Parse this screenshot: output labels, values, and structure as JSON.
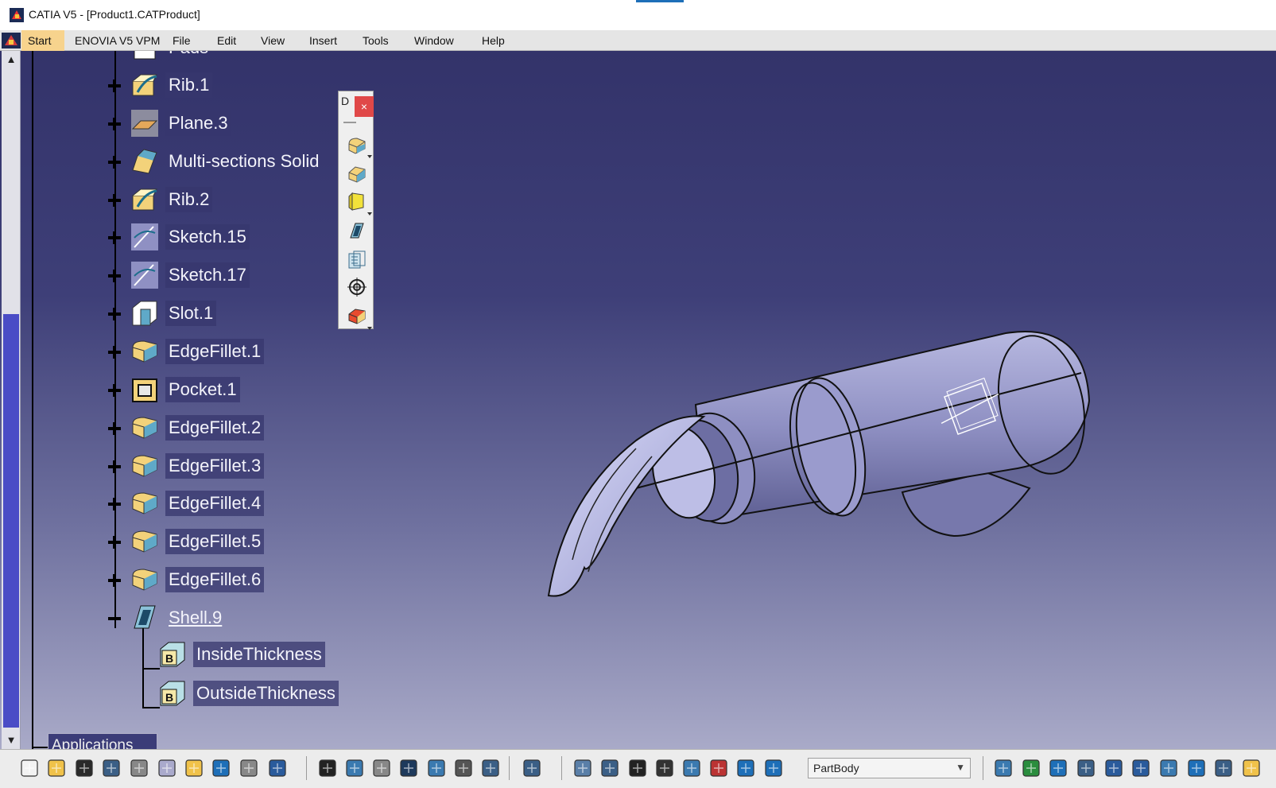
{
  "window": {
    "title": "CATIA V5 - [Product1.CATProduct]"
  },
  "menubar": {
    "items": [
      "Start",
      "ENOVIA V5 VPM",
      "File",
      "Edit",
      "View",
      "Insert",
      "Tools",
      "Window",
      "Help"
    ]
  },
  "tree": {
    "partial_top_label": "Pads",
    "nodes": [
      {
        "label": "Rib.1",
        "icon": "rib-icon"
      },
      {
        "label": "Plane.3",
        "icon": "plane-icon"
      },
      {
        "label": "Multi-sections Solid",
        "icon": "multi-sections-solid-icon"
      },
      {
        "label": "Rib.2",
        "icon": "rib-icon"
      },
      {
        "label": "Sketch.15",
        "icon": "sketch-icon"
      },
      {
        "label": "Sketch.17",
        "icon": "sketch-icon"
      },
      {
        "label": "Slot.1",
        "icon": "slot-icon"
      },
      {
        "label": "EdgeFillet.1",
        "icon": "edge-fillet-icon"
      },
      {
        "label": "Pocket.1",
        "icon": "pocket-icon"
      },
      {
        "label": "EdgeFillet.2",
        "icon": "edge-fillet-icon"
      },
      {
        "label": "EdgeFillet.3",
        "icon": "edge-fillet-icon"
      },
      {
        "label": "EdgeFillet.4",
        "icon": "edge-fillet-icon"
      },
      {
        "label": "EdgeFillet.5",
        "icon": "edge-fillet-icon"
      },
      {
        "label": "EdgeFillet.6",
        "icon": "edge-fillet-icon"
      },
      {
        "label": "Shell.9",
        "icon": "shell-icon"
      }
    ],
    "children": [
      {
        "label": "InsideThickness",
        "icon": "parameter-icon"
      },
      {
        "label": "OutsideThickness",
        "icon": "parameter-icon"
      }
    ]
  },
  "floating_toolbar": {
    "title": "D",
    "close": "×",
    "buttons": [
      "fillet-icon",
      "chamfer-icon",
      "draft-icon",
      "shell-icon",
      "thickness-icon",
      "thread-icon",
      "remove-face-icon"
    ]
  },
  "status": {
    "applications_tab": "Applications"
  },
  "bottom_toolbar": {
    "body_select_value": "PartBody",
    "tools": [
      "new-icon",
      "open-icon",
      "save-icon",
      "print-icon",
      "cut-icon",
      "copy-icon",
      "paste-icon",
      "undo-icon",
      "redo-icon",
      "whats-this-icon",
      "formula-icon",
      "knowledge-advisor-icon",
      "catalog-icon",
      "table-icon",
      "design-table-icon",
      "measure-icon",
      "law-icon",
      "image-icon",
      "fly-icon",
      "pan-icon",
      "axis-icon",
      "measure-between-icon",
      "swap-visible-icon",
      "hide-show-icon",
      "tree-expand-icon",
      "body-icon",
      "part-body-icon",
      "fit-all-icon",
      "move-icon",
      "rotate-icon",
      "zoom-in-icon",
      "zoom-out-icon",
      "normal-view-icon",
      "multi-view-icon",
      "iso-view-icon",
      "shading-icon"
    ]
  }
}
